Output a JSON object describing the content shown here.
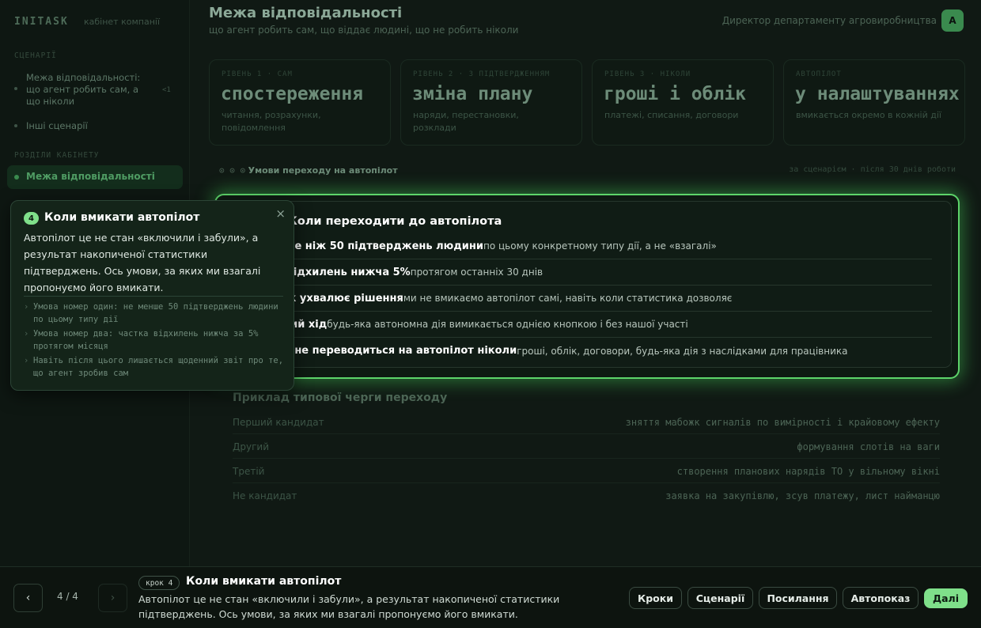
{
  "sidebar": {
    "brand": "INITASK",
    "brand_sub": "кабінет компанії",
    "section1": "СЦЕНАРІЇ",
    "nav_item1": "Межа відповідальності: що агент робить сам, а що ніколи",
    "nav_item1_badge": "<1",
    "nav_item2": "Інші сценарії",
    "section2": "РОЗДІЛИ КАБІНЕТУ",
    "active_item": "Межа відповідальності"
  },
  "header": {
    "title": "Межа відповідальності",
    "subtitle": "що агент робить сам, що віддає людині, що не робить ніколи",
    "user": "Директор департаменту агровиробництва",
    "avatar": "А"
  },
  "cards": [
    {
      "label": "РІВЕНЬ 1 · САМ",
      "big": "спостереження",
      "small": "читання, розрахунки, повідомлення"
    },
    {
      "label": "РІВЕНЬ 2 · З ПІДТВЕРДЖЕННЯМ",
      "big": "зміна плану",
      "small": "наряди, перестановки, розклади"
    },
    {
      "label": "РІВЕНЬ 3 · НІКОЛИ",
      "big": "гроші і облік",
      "small": "платежі, списання, договори"
    },
    {
      "label": "АВТОПІЛОТ",
      "big": "у налаштуваннях",
      "small": "вмикається окремо в кожній дії"
    }
  ],
  "breadcrumb": {
    "prefix": "⊙ ⊙ ⊙",
    "label": "Умови переходу на автопілот"
  },
  "meta_right": "за сценарієм · після 30 днів роботи",
  "panel": {
    "title": "Коли переходити до автопілота",
    "rows": [
      {
        "bold": "Не менше ніж 50 підтверджень людини",
        "text": "по цьому конкретному типу дії, а не «взагалі»"
      },
      {
        "bold": "Частка відхилень нижча 5%",
        "text": "протягом останніх 30 днів"
      },
      {
        "bold": "Керівник ухвалює рішення",
        "text": "ми не вмикаємо автопілот самі, навіть коли статистика дозволяє"
      },
      {
        "bold": "Зворотний хід",
        "text": "будь-яка автономна дія вимикається однією кнопкою і без нашої участі"
      },
      {
        "bold": "Рівень 3 не переводиться на автопілот ніколи",
        "text": "гроші, облік, договори, будь-яка дія з наслідками для працівника"
      }
    ]
  },
  "queue": {
    "title": "Приклад типової черги переходу",
    "rows": [
      {
        "k": "Перший кандидат",
        "v": "зняття мабожк сигналів по вимірності і крайовому ефекту"
      },
      {
        "k": "Другий",
        "v": "формування слотів на ваги"
      },
      {
        "k": "Третій",
        "v": "створення планових нарядів ТО у вільному вікні"
      },
      {
        "k": "Не кандидат",
        "v": "заявка на закупівлю, зсув платежу, лист найманцю"
      }
    ]
  },
  "tooltip": {
    "num": "4",
    "title": "Коли вмикати автопілот",
    "close": "×",
    "body": "Автопілот це не стан «включили і забули», а результат накопиченої статистики підтверджень. Ось умови, за яких ми взагалі пропонуємо його вмикати.",
    "list": [
      "Умова номер один: не менше 50 підтверджень людини по цьому типу дії",
      "Умова номер два: частка відхилень нижча за 5% протягом місяця",
      "Навіть після цього лишається щоденний звіт про те, що агент зробив сам"
    ]
  },
  "footer": {
    "prev": "‹",
    "next": "›",
    "counter": "4 / 4",
    "step_badge": "крок 4",
    "step_title": "Коли вмикати автопілот",
    "step_desc": "Автопілот це не стан «включили і забули», а результат накопиченої статистики підтверджень. Ось умови, за яких ми взагалі пропонуємо його вмикати.",
    "buttons": {
      "steps": "Кроки",
      "scenarios": "Сценарії",
      "links": "Посилання",
      "autoplay": "Автопоказ",
      "next": "Далі"
    }
  },
  "colors": {
    "accent": "#7fe08a",
    "panel_glow": "#5dd46a",
    "background": "#0b120e"
  }
}
